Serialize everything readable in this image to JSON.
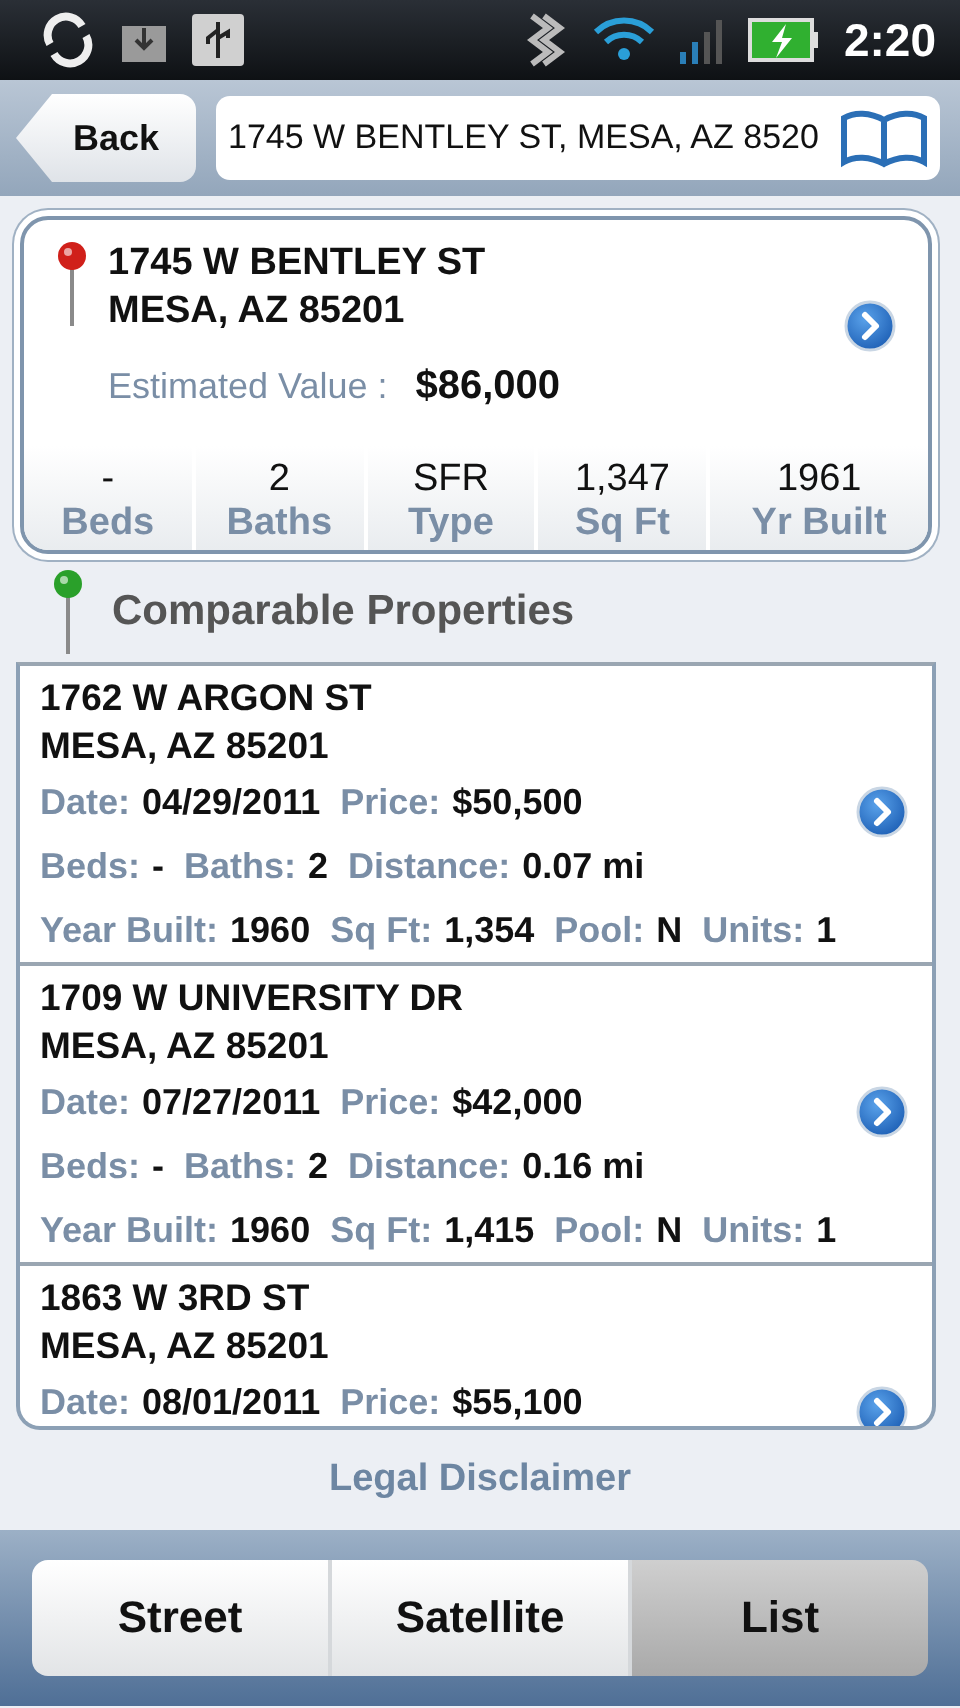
{
  "status_bar": {
    "time": "2:20"
  },
  "top_bar": {
    "back_button": "Back",
    "address_field": {
      "value": "1745 W BENTLEY ST, MESA, AZ 8520"
    }
  },
  "subject": {
    "address_line1": "1745 W BENTLEY ST",
    "address_line2": "MESA, AZ 85201",
    "estimated_value_label": "Estimated Value :",
    "estimated_value": "$86,000",
    "stats": [
      {
        "value": "-",
        "label": "Beds"
      },
      {
        "value": "2",
        "label": "Baths"
      },
      {
        "value": "SFR",
        "label": "Type"
      },
      {
        "value": "1,347",
        "label": "Sq Ft"
      },
      {
        "value": "1961",
        "label": "Yr Built"
      }
    ]
  },
  "comparables": {
    "title": "Comparable Properties",
    "items": [
      {
        "address_line1": "1762 W ARGON ST",
        "address_line2": "MESA, AZ 85201",
        "date_label": "Date:",
        "date": "04/29/2011",
        "price_label": "Price:",
        "price": "$50,500",
        "beds_label": "Beds:",
        "beds": "-",
        "baths_label": "Baths:",
        "baths": "2",
        "distance_label": "Distance:",
        "distance": "0.07 mi",
        "year_built_label": "Year Built:",
        "year_built": "1960",
        "sq_ft_label": "Sq Ft:",
        "sq_ft": "1,354",
        "pool_label": "Pool:",
        "pool": "N",
        "units_label": "Units:",
        "units": "1"
      },
      {
        "address_line1": "1709 W UNIVERSITY DR",
        "address_line2": "MESA, AZ 85201",
        "date_label": "Date:",
        "date": "07/27/2011",
        "price_label": "Price:",
        "price": "$42,000",
        "beds_label": "Beds:",
        "beds": "-",
        "baths_label": "Baths:",
        "baths": "2",
        "distance_label": "Distance:",
        "distance": "0.16 mi",
        "year_built_label": "Year Built:",
        "year_built": "1960",
        "sq_ft_label": "Sq Ft:",
        "sq_ft": "1,415",
        "pool_label": "Pool:",
        "pool": "N",
        "units_label": "Units:",
        "units": "1"
      },
      {
        "address_line1": "1863 W 3RD ST",
        "address_line2": "MESA, AZ 85201",
        "date_label": "Date:",
        "date": "08/01/2011",
        "price_label": "Price:",
        "price": "$55,100"
      }
    ]
  },
  "legal_disclaimer": "Legal Disclaimer",
  "view_tabs": [
    {
      "label": "Street",
      "selected": false
    },
    {
      "label": "Satellite",
      "selected": false
    },
    {
      "label": "List",
      "selected": true
    }
  ]
}
